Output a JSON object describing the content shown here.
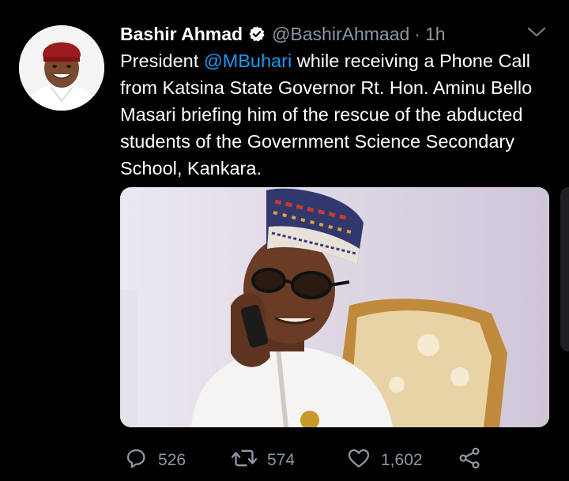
{
  "tweet": {
    "author_name": "Bashir Ahmad",
    "handle": "@BashirAhmaad",
    "separator": "·",
    "time": "1h",
    "text_before_mention": "President ",
    "mention": "@MBuhari",
    "text_after_mention": " while receiving a Phone Call from Katsina State Governor Rt. Hon. Aminu Bello Masari briefing him of the rescue of the abducted students of the Government Science Secondary School, Kankara."
  },
  "actions": {
    "replies": "526",
    "retweets": "574",
    "likes": "1,602"
  },
  "icons": {
    "verified": "verified-badge-icon",
    "more": "chevron-down-icon",
    "reply": "reply-icon",
    "retweet": "retweet-icon",
    "like": "heart-icon",
    "share": "share-icon"
  },
  "colors": {
    "background": "#000000",
    "mention": "#1d9bf0",
    "secondary_text": "#8b98a5"
  }
}
